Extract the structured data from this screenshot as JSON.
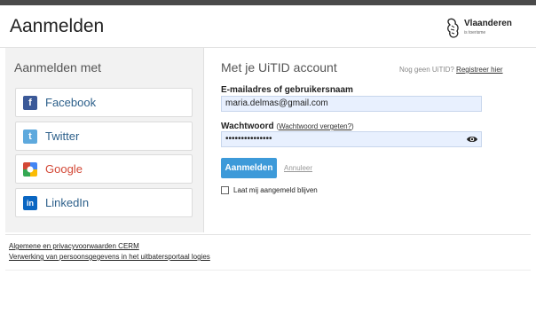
{
  "header": {
    "title": "Aanmelden",
    "logo": {
      "brand": "Vlaanderen",
      "sub": "is toerisme",
      "icon": "flemish-lion-icon"
    }
  },
  "left": {
    "title": "Aanmelden met",
    "providers": [
      {
        "label": "Facebook",
        "icon": "facebook-icon",
        "color": "#3b5998"
      },
      {
        "label": "Twitter",
        "icon": "twitter-icon",
        "color": "#5ea9dd"
      },
      {
        "label": "Google",
        "icon": "google-icon",
        "color": "#d34836"
      },
      {
        "label": "LinkedIn",
        "icon": "linkedin-icon",
        "color": "#0a66c2"
      }
    ]
  },
  "form": {
    "title": "Met je UiTID account",
    "no_account": "Nog geen UiTID?",
    "register_link": "Registreer hier",
    "email_label": "E-mailadres of gebruikersnaam",
    "email_value": "maria.delmas@gmail.com",
    "password_label": "Wachtwoord",
    "forgot_link": "Wachtwoord vergeten?",
    "password_value": "•••••••••••••••",
    "show_password_icon": "eye-icon",
    "login_button": "Aanmelden",
    "cancel_link": "Annuleer",
    "remember_label": "Laat mij aangemeld blijven",
    "remember_checked": false
  },
  "footer": {
    "links": [
      "Algemene en privacyvoorwaarden CERM",
      "Verwerking van persoonsgegevens in het uitbatersportaal logies"
    ]
  },
  "colors": {
    "accent": "#3d9ad9",
    "link": "#2c5f8a",
    "panel_bg": "#f2f2f2",
    "input_bg": "#e8f0fe"
  }
}
